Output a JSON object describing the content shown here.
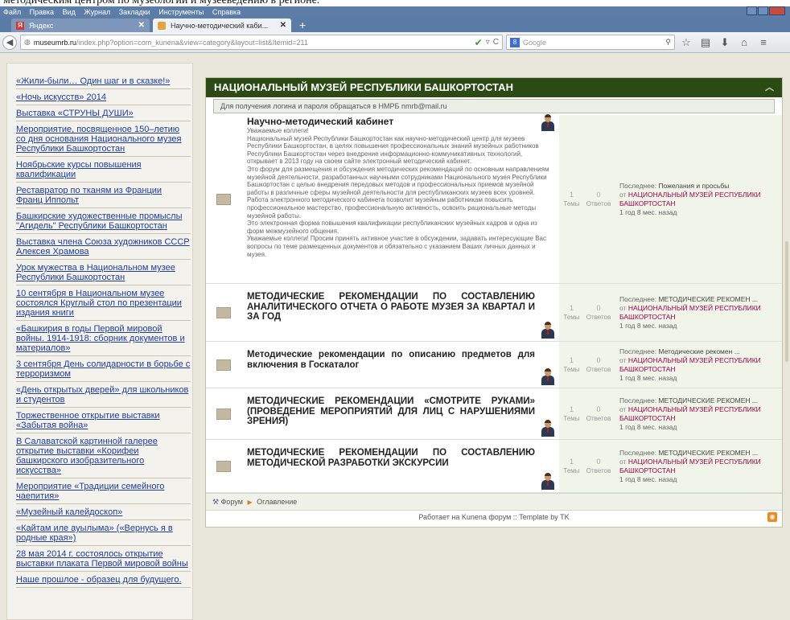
{
  "page_overtext": "методическим центром по музеологии и музееведению в регионе.",
  "menu": [
    "Файл",
    "Правка",
    "Вид",
    "Журнал",
    "Закладки",
    "Инструменты",
    "Справка"
  ],
  "tabs": [
    {
      "label": "Яндекс",
      "active": false
    },
    {
      "label": "Научно-методический каби...",
      "active": true
    }
  ],
  "url": {
    "host": "museumrb.ru",
    "path": "/index.php?option=com_kunena&view=category&layout=list&Itemid=211"
  },
  "search_placeholder": "Google",
  "sidebar_links": [
    "«Жили-были… Один шаг и в сказке!»",
    "«Ночь искусств» 2014",
    "Выставка «СТРУНЫ ДУШИ»",
    "Мероприятие, посвященное 150–летию со дня основания Национального музея Республики Башкортостан",
    "Ноябрьские курсы повышения квалификации",
    "Реставратор по тканям из Франции Франц Иппольт",
    "Башкирские художественные промыслы \"Агидель\" Республики Башкортостан",
    "Выставка члена Союза художников СССР Алексея Храмова",
    "Урок мужества в Национальном музее Республики Башкортостан",
    "10 сентября в Национальном музее состоялся Круглый стол по презентации издания книги",
    "«Башкирия в годы Первой мировой войны. 1914-1918: сборник документов и материалов»",
    "3 сентября День солидарности в борьбе с терроризмом",
    "«День открытых дверей» для школьников и студентов",
    "Торжественное открытие выставки «Забытая война»",
    "В Салаватской картинной галерее открытие выставки «Корифеи башкирского изобразительного искусства»",
    "Мероприятие «Традиции семейного чаепития»",
    "«Музейный калейдоскоп»",
    "«Кайтам иле ауылыма» («Вернусь я в родные края»)",
    "28 мая 2014 г. состоялось открытие выставки плаката Первой мировой войны",
    "Наше прошлое - образец для будущего."
  ],
  "category": {
    "title": "НАЦИОНАЛЬНЫЙ МУЗЕЙ РЕСПУБЛИКИ БАШКОРТОСТАН",
    "note": "Для получения логина и пароля обращаться в НМРБ nmrb@mail.ru"
  },
  "labels": {
    "topics": "Темы",
    "replies": "Ответов",
    "last_prefix": "Последнее:",
    "by_prefix": "от"
  },
  "forums": [
    {
      "title": "Научно-методический кабинет",
      "description": "Уважаемые коллеги!\nНациональный музей Республики Башкортостан как научно-методический центр для музеев Республики Башкортостан, в целях повышения профессиональных знаний музейных работников Республики Башкортостан через внедрение информационно-коммуникативных технологий, открывает в 2013 году на своем сайте электронный методический кабинет.\nЭто форум для размещения и обсуждения методических рекомендаций по основным направлениям музейной деятельности, разработанных научными сотрудниками Национального музея Республики Башкортостан с целью внедрения передовых методов и профессиональных приемов музейной работы в различные сферы музейной деятельности для республиканских музеев всех уровней.\nРабота электронного методического кабинета позволит музейным работникам повысить профессиональное мастерство, профессиональную активность, освоить рациональные методы музейной работы.\nЭто электронная форма повышения квалификации республиканских музейных кадров и одна из форм межмузейного общения.\nУважаемые коллеги! Просим принять активное участие в обсуждении, задавать интересующие Вас вопросы по теме размещенных документов и обязательно с указанием Ваших личных данных и музея.",
      "topics": "1",
      "replies": "0",
      "last_topic": "Пожелания и просьбы",
      "last_author": "НАЦИОНАЛЬНЫЙ МУЗЕЙ РЕСПУБЛИКИ БАШКОРТОСТАН",
      "last_time": "1 год 8 мес. назад"
    },
    {
      "title": "МЕТОДИЧЕСКИЕ РЕКОМЕНДАЦИИ ПО СОСТАВЛЕНИЮ АНАЛИТИЧЕСКОГО ОТЧЕТА О РАБОТЕ МУЗЕЯ ЗА КВАРТАЛ И ЗА ГОД",
      "topics": "1",
      "replies": "0",
      "last_topic": "МЕТОДИЧЕСКИЕ РЕКОМЕН ...",
      "last_author": "НАЦИОНАЛЬНЫЙ МУЗЕЙ РЕСПУБЛИКИ БАШКОРТОСТАН",
      "last_time": "1 год 8 мес. назад"
    },
    {
      "title": "Методические рекомендации по описанию предметов для включения в Госкаталог",
      "topics": "1",
      "replies": "0",
      "last_topic": "Методические рекомен ...",
      "last_author": "НАЦИОНАЛЬНЫЙ МУЗЕЙ РЕСПУБЛИКИ БАШКОРТОСТАН",
      "last_time": "1 год 8 мес. назад"
    },
    {
      "title": "МЕТОДИЧЕСКИЕ РЕКОМЕНДАЦИИ «СМОТРИТЕ РУКАМИ» (ПРОВЕДЕНИЕ МЕРОПРИЯТИЙ ДЛЯ ЛИЦ С НАРУШЕНИЯМИ ЗРЕНИЯ)",
      "topics": "1",
      "replies": "0",
      "last_topic": "МЕТОДИЧЕСКИЕ РЕКОМЕН ...",
      "last_author": "НАЦИОНАЛЬНЫЙ МУЗЕЙ РЕСПУБЛИКИ БАШКОРТОСТАН",
      "last_time": "1 год 8 мес. назад"
    },
    {
      "title": "МЕТОДИЧЕСКИЕ РЕКОМЕНДАЦИИ ПО СОСТАВЛЕНИЮ МЕТОДИЧЕСКОЙ РАЗРАБОТКИ ЭКСКУРСИИ",
      "topics": "1",
      "replies": "0",
      "last_topic": "МЕТОДИЧЕСКИЕ РЕКОМЕН ...",
      "last_author": "НАЦИОНАЛЬНЫЙ МУЗЕЙ РЕСПУБЛИКИ БАШКОРТОСТАН",
      "last_time": "1 год 8 мес. назад"
    }
  ],
  "breadcrumbs": [
    "Форум",
    "Оглавление"
  ],
  "footer": "Работает на Kunena форум :: Template by TK",
  "colors": {
    "category_header": "#2c4a13",
    "link": "#1f3d9e",
    "author": "#a3004a",
    "tab_bar": "#5b7ca7"
  }
}
